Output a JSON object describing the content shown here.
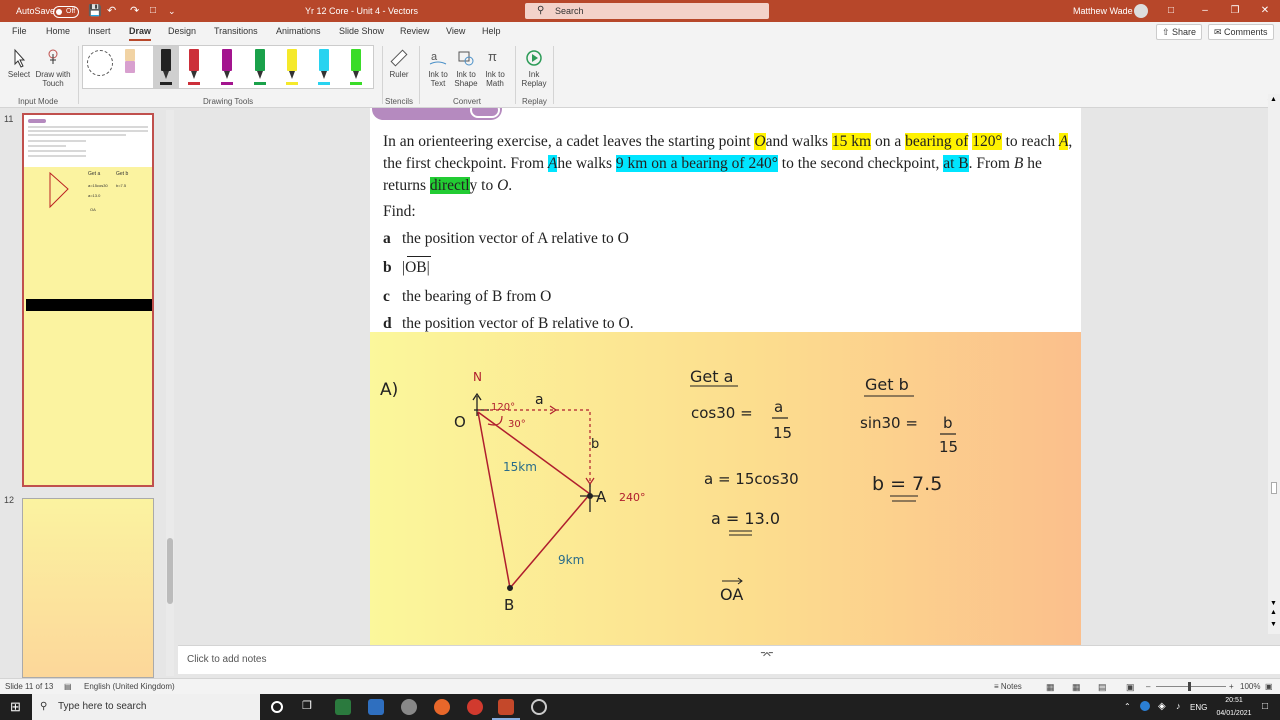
{
  "titlebar": {
    "autosave_label": "AutoSave",
    "autosave_state": "Off",
    "doc_title": "Yr 12 Core - Unit 4 - Vectors",
    "search_placeholder": "Search",
    "user_name": "Matthew Wade"
  },
  "tabs": [
    "File",
    "Home",
    "Insert",
    "Draw",
    "Design",
    "Transitions",
    "Animations",
    "Slide Show",
    "Review",
    "View",
    "Help"
  ],
  "active_tab": "Draw",
  "share_label": "Share",
  "comments_label": "Comments",
  "ribbon": {
    "select": "Select",
    "draw_with": "Draw with",
    "touch": "Touch",
    "input_mode": "Input Mode",
    "drawing_tools": "Drawing Tools",
    "ruler": "Ruler",
    "stencils": "Stencils",
    "ink_to_text_1": "Ink to",
    "ink_to_text_2": "Text",
    "ink_to_shape_1": "Ink to",
    "ink_to_shape_2": "Shape",
    "ink_to_math_1": "Ink to",
    "ink_to_math_2": "Math",
    "convert": "Convert",
    "ink_replay_1": "Ink",
    "ink_replay_2": "Replay",
    "replay": "Replay",
    "pens": [
      {
        "color": "#cc2f3a",
        "name": "red-pen"
      },
      {
        "color": "#a3148e",
        "name": "purple-pen"
      },
      {
        "color": "#1aa14a",
        "name": "green-pen"
      },
      {
        "color": "#f5e92a",
        "name": "yellow-highlighter"
      },
      {
        "color": "#28d3f0",
        "name": "cyan-highlighter"
      },
      {
        "color": "#3adc28",
        "name": "green-highlighter"
      }
    ]
  },
  "thumbnails": {
    "slide_11": "11",
    "slide_12": "12"
  },
  "slide": {
    "problem_parts": {
      "p1": "In an orienteering exercise, a cadet leaves the starting point ",
      "O": "O",
      "p2": "and walks ",
      "dist1": "15 km",
      "p3": " on a ",
      "bearing1": "bearing of",
      "angle1": "120°",
      "p4": " to reach ",
      "A1": "A",
      "p5": ", the first checkpoint. From ",
      "A2": "A",
      "p6": "he walks ",
      "leg2": "9 km on a bearing of 240°",
      "p7": " to the second checkpoint, ",
      "atB": "at B",
      "p8": ". From ",
      "B1": "B",
      "p9": " he returns ",
      "directly": "directl",
      "p10": "y to ",
      "O2": "O",
      "p11": "."
    },
    "find": "Find:",
    "parts": [
      {
        "letter": "a",
        "text": "the position vector of A relative to O"
      },
      {
        "letter": "b",
        "text": "|OB|"
      },
      {
        "letter": "c",
        "text": "the bearing of B from O"
      },
      {
        "letter": "d",
        "text": "the position vector of B relative to O."
      }
    ],
    "handwriting": {
      "part_label": "A)",
      "north": "N",
      "O_label": "O",
      "angle_120": "120°",
      "angle_30": "30°",
      "a_label": "a",
      "b_label": "b",
      "leg1": "15km",
      "A_label": "A",
      "bearing_240": "240°",
      "leg2": "9km",
      "B_label": "B",
      "get_a": "Get a",
      "cos_eq_lhs": "cos30 =",
      "cos_num": "a",
      "cos_den": "15",
      "a_expr": "a = 15cos30",
      "a_result": "a = 13.0",
      "OA": "OA",
      "get_b": "Get b",
      "sin_eq_lhs": "sin30 =",
      "sin_num": "b",
      "sin_den": "15",
      "b_result": "b = 7.5"
    }
  },
  "notes_placeholder": "Click to add notes",
  "status": {
    "slide_counter": "Slide 11 of 13",
    "language": "English (United Kingdom)",
    "notes": "Notes",
    "zoom": "100%"
  },
  "taskbar": {
    "search_placeholder": "Type here to search",
    "lang": "ENG",
    "time": "20:51",
    "date": "04/01/2021"
  }
}
